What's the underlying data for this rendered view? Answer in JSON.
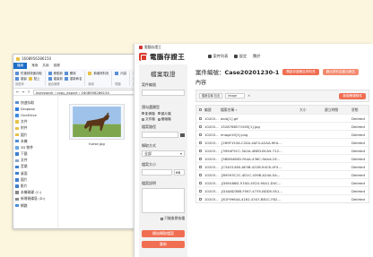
{
  "explorer": {
    "title": "1608956286150",
    "ribbon_tabs": [
      "檔案",
      "常用",
      "共用",
      "檢視"
    ],
    "ribbon": {
      "clipboard": [
        "釘選到快速存取",
        "複製",
        "貼上"
      ],
      "organize": [
        "移動到",
        "複製到",
        "刪除",
        "重新命名"
      ],
      "new": [
        "新增資料夾"
      ],
      "open": [
        "內容"
      ],
      "select": [
        "全選",
        "全部不選",
        "反向選擇"
      ],
      "group_names": [
        "剪貼簿",
        "組合管理",
        "新增",
        "開啟",
        "選取"
      ]
    },
    "address": "Userswork › copy_export › 1608956286150",
    "nav_items": [
      "快速存取",
      "Dropbox",
      "OneDrive",
      "文件",
      "附件",
      "圖片",
      "本機",
      "3D 物件",
      "下載",
      "文件",
      "音樂",
      "桌面",
      "圖片",
      "影片",
      "本機磁碟 (C:)",
      "新增磁碟區 (D:)",
      "網路"
    ],
    "file_name": "horse.jpg"
  },
  "app": {
    "window_title": "電腦存證王",
    "logo_text": "電腦存證王",
    "nav": [
      "案件列表",
      "設定",
      "關於"
    ],
    "left": {
      "title": "檔案取證",
      "case_label": "案件編號",
      "type_label": "請勾選類型",
      "type_options": [
        "影像檔",
        "圖片檔",
        "文件檔",
        "壓縮檔"
      ],
      "folder_label": "檔案路徑",
      "scan_label": "擷取方式",
      "scan_value": "全部",
      "size_label": "檔案大小",
      "size_unit": "KB",
      "note_label": "檔案說明",
      "check_label": "只檢查原始檔",
      "btn_primary": "開始擷取檔案",
      "btn_secondary": "重新"
    },
    "right": {
      "case_prefix": "案件編號：",
      "case_number": "Case20201230-1",
      "pill1": "開啟存證報告資料夾",
      "pill2": "匯出資料並產出報告",
      "content_title": "內容",
      "filter_field": "檔案名稱 包含",
      "filter_value": "image",
      "filter_btn": "新增篩選條件",
      "columns": [
        "",
        "編號",
        "檔案名稱",
        "大小",
        "建立時間",
        "狀態"
      ],
      "rows": [
        {
          "id": "10203...",
          "name": "dolo[1].gif",
          "size": "",
          "time": "",
          "status": "Deleted"
        },
        {
          "id": "10203...",
          "name": "1528768571905[1].jpg",
          "size": "",
          "time": "",
          "status": "Deleted"
        },
        {
          "id": "10203...",
          "name": "image19[1].png",
          "size": "",
          "time": "",
          "status": "Deleted"
        },
        {
          "id": "10203...",
          "name": "{269F153A-C20A-4AF4-A2AA-9EA...",
          "size": "",
          "time": "",
          "status": "Deleted"
        },
        {
          "id": "10203...",
          "name": "{3994F5CC-3A2A-4BED-BCA9-712...",
          "size": "",
          "time": "",
          "status": "Deleted"
        },
        {
          "id": "10203...",
          "name": "{5BD8480D-FA4A-436C-9AAA-2E...",
          "size": "",
          "time": "",
          "status": "Deleted"
        },
        {
          "id": "10203...",
          "name": "{C5A31460-AE5B-422B-94C6-4F4...",
          "size": "",
          "time": "",
          "status": "Deleted"
        },
        {
          "id": "10203...",
          "name": "{B9593C2C-4D1C-4398-A24A-5A...",
          "size": "",
          "time": "",
          "status": "Deleted"
        },
        {
          "id": "10203...",
          "name": "{D65486D-57AD-4524-90A1-D0C...",
          "size": "",
          "time": "",
          "status": "Deleted"
        },
        {
          "id": "10203...",
          "name": "{D4A8D38B-F567-4735-BDD5-FA1...",
          "size": "",
          "time": "",
          "status": "Deleted"
        },
        {
          "id": "10203...",
          "name": "{81F9964A-4162-4347-B81C-F82...",
          "size": "",
          "time": "",
          "status": "Deleted"
        }
      ]
    }
  },
  "colors": {
    "background": "#fdf6df",
    "accent": "#f06e52",
    "brand_red": "#d93a2b",
    "explorer_blue": "#1c6dc7"
  }
}
